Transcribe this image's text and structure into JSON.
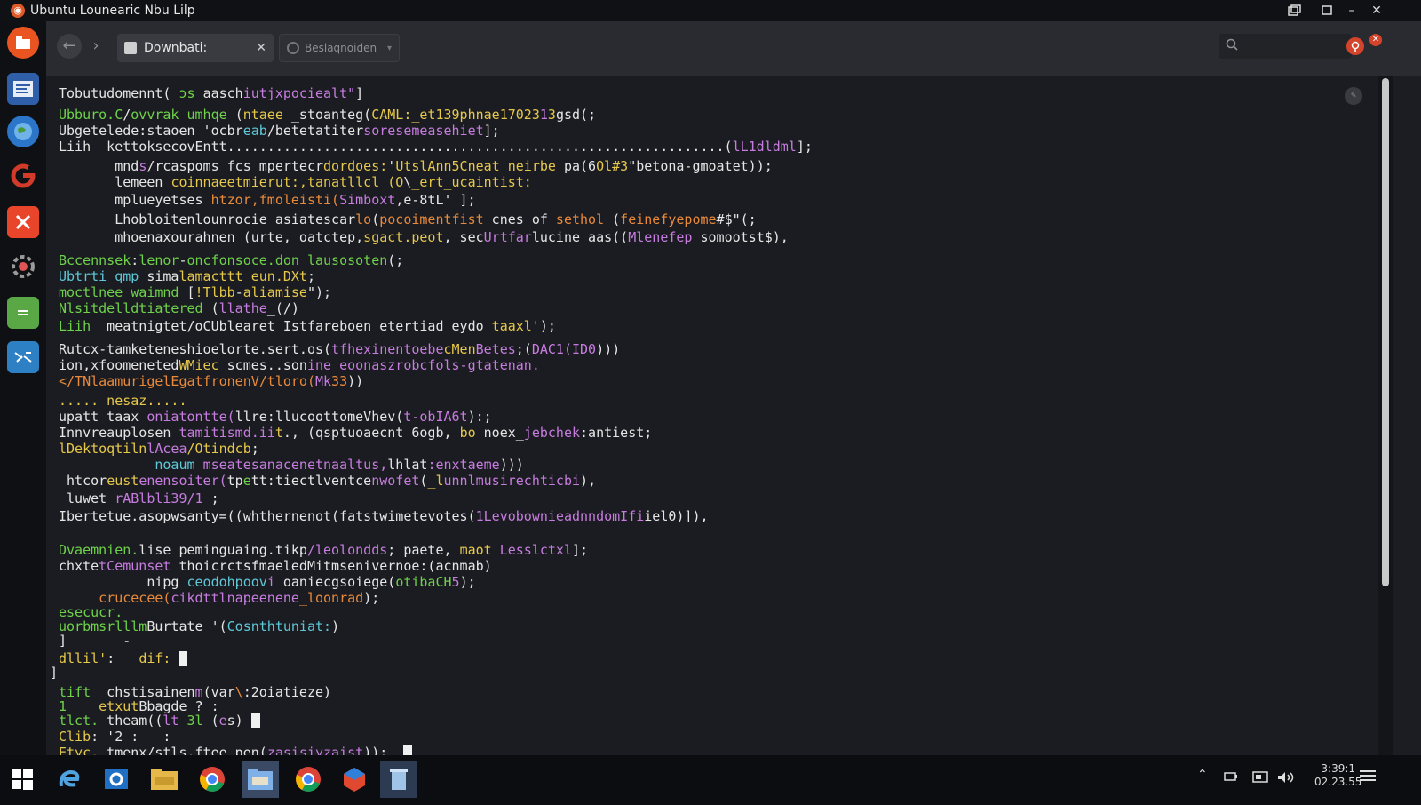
{
  "window": {
    "title": "Ubuntu Lounearic  Nbu Lilp"
  },
  "titlebar": {
    "restore_icon": "restore-icon",
    "maximize_icon": "maximize-icon",
    "minimize_label": "–",
    "close_label": "✕"
  },
  "launcher": {
    "items": [
      {
        "name": "ubuntu-home",
        "color": "#e95420"
      },
      {
        "name": "text-editor",
        "color": "#2f5fa8"
      },
      {
        "name": "web-browser",
        "color": "#2b76c9"
      },
      {
        "name": "google-app",
        "color": "#d23a2a"
      },
      {
        "name": "close-app",
        "color": "#e8452a"
      },
      {
        "name": "system-settings",
        "color": "#8a8a8a"
      },
      {
        "name": "spreadsheet",
        "color": "#5aa845"
      },
      {
        "name": "remote-desktop",
        "color": "#2e80c5"
      }
    ]
  },
  "toolbar": {
    "tabs": [
      {
        "label": "Downbati:",
        "close": "✕"
      },
      {
        "label": "Beslaqnoiden"
      }
    ]
  },
  "terminal": {
    "lines": [
      {
        "segs": [
          [
            "w",
            "Tobutudomennt( "
          ],
          [
            "g",
            "ɔs "
          ],
          [
            "w",
            "aasch"
          ],
          [
            "p",
            "iutjxpociealt\""
          ],
          [
            "w",
            "]"
          ]
        ]
      },
      {
        "segs": [
          [
            "g",
            "Ubburo.C"
          ],
          [
            "w",
            "/"
          ],
          [
            "g",
            "ovvrak umhqe "
          ],
          [
            "w",
            "("
          ],
          [
            "y",
            "ntaee "
          ],
          [
            "w",
            "_stoanteg("
          ],
          [
            "y",
            "CAML:_et139phnae17023"
          ],
          [
            "p",
            "1"
          ],
          [
            "y",
            "3"
          ],
          [
            "w",
            "gsd(;"
          ]
        ]
      },
      {
        "segs": [
          [
            "w",
            "Ubgetelede:staoen 'ocbr"
          ],
          [
            "c",
            "eab"
          ],
          [
            "w",
            "/betetatiter"
          ],
          [
            "p",
            "soresemeasehiet"
          ],
          [
            "w",
            "];"
          ]
        ]
      },
      {
        "segs": [
          [
            "w",
            "Liih  kettoksecovEntt..............................................................("
          ],
          [
            "p",
            "lL1dldml"
          ],
          [
            "w",
            "];"
          ]
        ]
      },
      {
        "segs": [
          [
            "w",
            "       mnd"
          ],
          [
            "p",
            "s"
          ],
          [
            "w",
            "/rcaspoms fcs mpertecr"
          ],
          [
            "y",
            "dordoes:"
          ],
          [
            "w",
            "'"
          ],
          [
            "y",
            "UtslAnn5Cneat neirbe"
          ],
          [
            "w",
            " pa(6"
          ],
          [
            "y",
            "Ol#3"
          ],
          [
            "w",
            "\"betona-gmoatet));"
          ]
        ]
      },
      {
        "segs": [
          [
            "w",
            "       lemeen "
          ],
          [
            "y",
            "coinnaeetmierut:,tanatllcl (O"
          ],
          [
            "w",
            "\\"
          ],
          [
            "y",
            "_ert_ucaintist:"
          ]
        ]
      },
      {
        "segs": [
          [
            "w",
            "       mplueyetses "
          ],
          [
            "o",
            "htzor,fmoleisti("
          ],
          [
            "p",
            "Simboxt"
          ],
          [
            "w",
            ",e-8tL' ];"
          ]
        ]
      },
      {
        "segs": [
          [
            "w",
            "       Lhobloitenlounrocie asiatescar"
          ],
          [
            "o",
            "lo"
          ],
          [
            "w",
            "("
          ],
          [
            "o",
            "pocoimentfist"
          ],
          [
            "w",
            "_cnes of "
          ],
          [
            "o",
            "sethol"
          ],
          [
            "w",
            " ("
          ],
          [
            "o",
            "feinefyepome"
          ],
          [
            "w",
            "#$\"(;"
          ]
        ]
      },
      {
        "segs": [
          [
            "w",
            "       mhoenaxourahnen (urte, oatctep,"
          ],
          [
            "y",
            "sgact.peot"
          ],
          [
            "w",
            ", sec"
          ],
          [
            "p",
            "Urtfar"
          ],
          [
            "w",
            "lucine aas(("
          ],
          [
            "p",
            "Mlenefep"
          ],
          [
            "w",
            " somootst$),"
          ]
        ]
      },
      {
        "segs": [
          [
            "g",
            "Bccennsek"
          ],
          [
            "w",
            ":"
          ],
          [
            "g",
            "lenor"
          ],
          [
            "w",
            "-"
          ],
          [
            "g",
            "oncfonsoce.don lausosoten"
          ],
          [
            "w",
            "(;"
          ]
        ]
      },
      {
        "segs": [
          [
            "c",
            "Ubtrti qmp"
          ],
          [
            "w",
            " sima"
          ],
          [
            "y",
            "lamacttt eun.DXt"
          ],
          [
            "w",
            ";"
          ]
        ]
      },
      {
        "segs": [
          [
            "g",
            "moctlnee waimnd"
          ],
          [
            "w",
            " ["
          ],
          [
            "y",
            "!Tlbb"
          ],
          [
            "w",
            "-"
          ],
          [
            "y",
            "aliamise"
          ],
          [
            "w",
            "\");"
          ]
        ]
      },
      {
        "segs": [
          [
            "g",
            "Nlsitdelldtiatered"
          ],
          [
            "w",
            " ("
          ],
          [
            "p",
            "llathe"
          ],
          [
            "w",
            "_(/)"
          ]
        ]
      },
      {
        "segs": [
          [
            "g",
            "Liih"
          ],
          [
            "w",
            "  meatnigtet/oCUblearet Istfareboen etertiad eydo "
          ],
          [
            "y",
            "taaxl"
          ],
          [
            "w",
            "');"
          ]
        ]
      },
      {
        "segs": [
          [
            "w",
            "Rutcx-tamketeneshioelorte.sert.os("
          ],
          [
            "p",
            "tfhexinentoebe"
          ],
          [
            "y",
            "cMen"
          ],
          [
            "p",
            "Betes"
          ],
          [
            "w",
            ";("
          ],
          [
            "p",
            "DAC1(ID0"
          ],
          [
            "w",
            ")))"
          ]
        ]
      },
      {
        "segs": [
          [
            "w",
            "ion,xfoomeneted"
          ],
          [
            "y",
            "WMiec"
          ],
          [
            "w",
            " scmes..son"
          ],
          [
            "p",
            "ine eoonaszrobcfols-gtatenan."
          ]
        ]
      },
      {
        "segs": [
          [
            "o",
            "</TNlaamurigelEgatfronenV/tloro("
          ],
          [
            "p",
            "Mk"
          ],
          [
            "o",
            "33"
          ],
          [
            "w",
            "))"
          ]
        ]
      },
      {
        "segs": [
          [
            "y",
            "..... nesaz....."
          ]
        ]
      },
      {
        "segs": [
          [
            "w",
            "upatt taax "
          ],
          [
            "p",
            "oniatontte("
          ],
          [
            "w",
            "llre:llucoottomeVhev("
          ],
          [
            "p",
            "t-obIA6t"
          ],
          [
            "w",
            "):;"
          ]
        ]
      },
      {
        "segs": [
          [
            "w",
            "Innvreauplosen "
          ],
          [
            "p",
            "tamitismd.ii"
          ],
          [
            "y",
            "t"
          ],
          [
            "w",
            "., (qsptuoaecnt 6ogb, "
          ],
          [
            "y",
            "bo "
          ],
          [
            "w",
            "noex_"
          ],
          [
            "p",
            "jebchek"
          ],
          [
            "w",
            ":antiest;"
          ]
        ]
      },
      {
        "segs": [
          [
            "y",
            "lDektoqtiln"
          ],
          [
            "p",
            "lAcea"
          ],
          [
            "y",
            "/Otindcb"
          ],
          [
            "w",
            ";"
          ]
        ]
      },
      {
        "segs": [
          [
            "w",
            "            "
          ],
          [
            "c",
            "noaum "
          ],
          [
            "p",
            "mseatesanacenetnaaltus,"
          ],
          [
            "w",
            "lhlat"
          ],
          [
            "p",
            ":enxtaeme"
          ],
          [
            "w",
            ")))"
          ]
        ]
      },
      {
        "segs": [
          [
            "w",
            " htcor"
          ],
          [
            "y",
            "eust"
          ],
          [
            "p",
            "enensoiter("
          ],
          [
            "w",
            "tp"
          ],
          [
            "g",
            "e"
          ],
          [
            "w",
            "tt:tiectlventce"
          ],
          [
            "p",
            "nwofet"
          ],
          [
            "w",
            "("
          ],
          [
            "y",
            "_l"
          ],
          [
            "p",
            "unnlmusirechticbi"
          ],
          [
            "w",
            "),"
          ]
        ]
      },
      {
        "segs": [
          [
            "w",
            " luwet "
          ],
          [
            "p",
            "rABlbli39/1"
          ],
          [
            "w",
            " ;"
          ]
        ]
      },
      {
        "segs": [
          [
            "w",
            "Ibertetue.asopwsanty=((whthernenot(fatstwimetevotes("
          ],
          [
            "p",
            "1LevobownieadnndomIfi"
          ],
          [
            "w",
            "iel0)]),"
          ]
        ]
      },
      {
        "segs": []
      },
      {
        "segs": [
          [
            "g",
            "Dvaemnien."
          ],
          [
            "w",
            "lise peminguaing.tikp"
          ],
          [
            "p",
            "/leolondds"
          ],
          [
            "w",
            "; paete, "
          ],
          [
            "y",
            "maot"
          ],
          [
            "p",
            " Lesslctxl"
          ],
          [
            "w",
            "];"
          ]
        ]
      },
      {
        "segs": [
          [
            "w",
            "chxte"
          ],
          [
            "p",
            "tCemunset"
          ],
          [
            "w",
            " thoicrctsfmaeledMitmsenivernoe"
          ],
          [
            "w",
            ":(acnmab)"
          ]
        ]
      },
      {
        "segs": [
          [
            "w",
            "           nipg "
          ],
          [
            "c",
            "ceodohpoov"
          ],
          [
            "p",
            "i"
          ],
          [
            "w",
            " oaniecgsoiege("
          ],
          [
            "g",
            "otibaCH"
          ],
          [
            "p",
            "5"
          ],
          [
            "w",
            ");"
          ]
        ]
      },
      {
        "segs": [
          [
            "w",
            "     "
          ],
          [
            "o",
            "crucecee("
          ],
          [
            "p",
            "cikdttlnapeenene"
          ],
          [
            "o",
            "_loonrad"
          ],
          [
            "w",
            ");"
          ]
        ]
      },
      {
        "segs": [
          [
            "g",
            "esecucr."
          ]
        ]
      },
      {
        "segs": [
          [
            "g",
            "uorbmsrlllm"
          ],
          [
            "w",
            "Burtate '("
          ],
          [
            "c",
            "Cosnthtuniat:"
          ],
          [
            "w",
            ")"
          ]
        ]
      },
      {
        "segs": [
          [
            "w",
            "]       -"
          ]
        ]
      },
      {
        "segs": [
          [
            "y",
            "dllil'"
          ],
          [
            "w",
            ":   "
          ],
          [
            "y",
            "dif:"
          ],
          [
            "w",
            " "
          ],
          [
            "cur",
            ""
          ]
        ]
      },
      {
        "segs": [
          [
            "w",
            "]"
          ]
        ]
      },
      {
        "segs": [
          [
            "g",
            "tift"
          ],
          [
            "w",
            "  chstisainen"
          ],
          [
            "p",
            "m"
          ],
          [
            "w",
            "(var"
          ],
          [
            "o",
            "\\"
          ],
          [
            "w",
            ":2oiatieze)"
          ]
        ]
      },
      {
        "segs": [
          [
            "g",
            "1"
          ],
          [
            "w",
            "    "
          ],
          [
            "y",
            "etxut"
          ],
          [
            "w",
            "Bbagde "
          ],
          [
            "w",
            "?"
          ],
          [
            "w",
            " :"
          ]
        ]
      },
      {
        "segs": [
          [
            "g",
            "tlct."
          ],
          [
            "w",
            " theam(("
          ],
          [
            "p",
            "lt"
          ],
          [
            "w",
            " "
          ],
          [
            "g",
            "3l"
          ],
          [
            "w",
            " ("
          ],
          [
            "p",
            "e"
          ],
          [
            "w",
            "s) "
          ],
          [
            "cur",
            ""
          ]
        ]
      },
      {
        "segs": [
          [
            "y",
            "Clib"
          ],
          [
            "w",
            ": '2 :   :"
          ]
        ]
      },
      {
        "segs": [
          [
            "y",
            "Etyc."
          ],
          [
            "w",
            " tmenx/stls.ftee pen("
          ],
          [
            "p",
            "zasisiyzaist"
          ],
          [
            "w",
            "));  "
          ],
          [
            "cur",
            ""
          ]
        ]
      }
    ]
  },
  "taskbar": {
    "items": [
      "windows-start",
      "edge-browser",
      "outlook",
      "file-explorer",
      "chrome",
      "file-manager",
      "chrome-2",
      "app-store",
      "recycle-bin"
    ],
    "clock_time": "3:39:1",
    "clock_date": "02.23.55"
  }
}
